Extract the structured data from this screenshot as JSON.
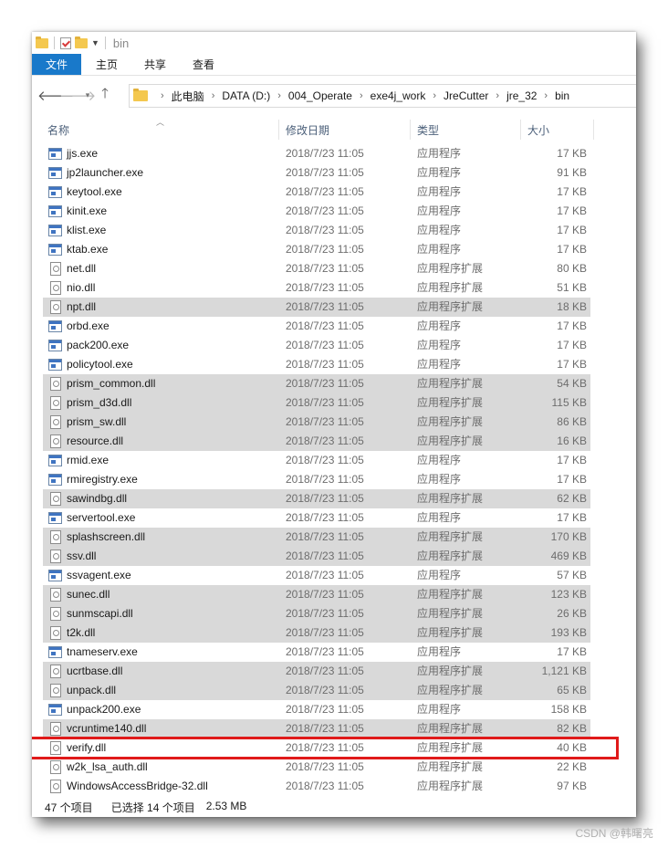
{
  "window": {
    "title": "bin"
  },
  "ribbon": {
    "tabs": [
      {
        "label": "文件",
        "active": true
      },
      {
        "label": "主页"
      },
      {
        "label": "共享"
      },
      {
        "label": "查看"
      }
    ]
  },
  "nav": {
    "back_icon": "arrow-left-icon",
    "forward_icon": "arrow-right-icon",
    "recent_icon": "chevron-down-icon",
    "up_icon": "arrow-up-icon"
  },
  "breadcrumb": [
    "此电脑",
    "DATA (D:)",
    "004_Operate",
    "exe4j_work",
    "JreCutter",
    "jre_32",
    "bin"
  ],
  "columns": {
    "name": "名称",
    "date": "修改日期",
    "type": "类型",
    "size": "大小"
  },
  "files": [
    {
      "name": "jjs.exe",
      "date": "2018/7/23 11:05",
      "type": "应用程序",
      "size": "17 KB",
      "kind": "exe",
      "selected": false
    },
    {
      "name": "jp2launcher.exe",
      "date": "2018/7/23 11:05",
      "type": "应用程序",
      "size": "91 KB",
      "kind": "exe",
      "selected": false
    },
    {
      "name": "keytool.exe",
      "date": "2018/7/23 11:05",
      "type": "应用程序",
      "size": "17 KB",
      "kind": "exe",
      "selected": false
    },
    {
      "name": "kinit.exe",
      "date": "2018/7/23 11:05",
      "type": "应用程序",
      "size": "17 KB",
      "kind": "exe",
      "selected": false
    },
    {
      "name": "klist.exe",
      "date": "2018/7/23 11:05",
      "type": "应用程序",
      "size": "17 KB",
      "kind": "exe",
      "selected": false
    },
    {
      "name": "ktab.exe",
      "date": "2018/7/23 11:05",
      "type": "应用程序",
      "size": "17 KB",
      "kind": "exe",
      "selected": false
    },
    {
      "name": "net.dll",
      "date": "2018/7/23 11:05",
      "type": "应用程序扩展",
      "size": "80 KB",
      "kind": "dll",
      "selected": false
    },
    {
      "name": "nio.dll",
      "date": "2018/7/23 11:05",
      "type": "应用程序扩展",
      "size": "51 KB",
      "kind": "dll",
      "selected": false
    },
    {
      "name": "npt.dll",
      "date": "2018/7/23 11:05",
      "type": "应用程序扩展",
      "size": "18 KB",
      "kind": "dll",
      "selected": true
    },
    {
      "name": "orbd.exe",
      "date": "2018/7/23 11:05",
      "type": "应用程序",
      "size": "17 KB",
      "kind": "exe",
      "selected": false
    },
    {
      "name": "pack200.exe",
      "date": "2018/7/23 11:05",
      "type": "应用程序",
      "size": "17 KB",
      "kind": "exe",
      "selected": false
    },
    {
      "name": "policytool.exe",
      "date": "2018/7/23 11:05",
      "type": "应用程序",
      "size": "17 KB",
      "kind": "exe",
      "selected": false
    },
    {
      "name": "prism_common.dll",
      "date": "2018/7/23 11:05",
      "type": "应用程序扩展",
      "size": "54 KB",
      "kind": "dll",
      "selected": true
    },
    {
      "name": "prism_d3d.dll",
      "date": "2018/7/23 11:05",
      "type": "应用程序扩展",
      "size": "115 KB",
      "kind": "dll",
      "selected": true
    },
    {
      "name": "prism_sw.dll",
      "date": "2018/7/23 11:05",
      "type": "应用程序扩展",
      "size": "86 KB",
      "kind": "dll",
      "selected": true
    },
    {
      "name": "resource.dll",
      "date": "2018/7/23 11:05",
      "type": "应用程序扩展",
      "size": "16 KB",
      "kind": "dll",
      "selected": true
    },
    {
      "name": "rmid.exe",
      "date": "2018/7/23 11:05",
      "type": "应用程序",
      "size": "17 KB",
      "kind": "exe",
      "selected": false
    },
    {
      "name": "rmiregistry.exe",
      "date": "2018/7/23 11:05",
      "type": "应用程序",
      "size": "17 KB",
      "kind": "exe",
      "selected": false
    },
    {
      "name": "sawindbg.dll",
      "date": "2018/7/23 11:05",
      "type": "应用程序扩展",
      "size": "62 KB",
      "kind": "dll",
      "selected": true
    },
    {
      "name": "servertool.exe",
      "date": "2018/7/23 11:05",
      "type": "应用程序",
      "size": "17 KB",
      "kind": "exe",
      "selected": false
    },
    {
      "name": "splashscreen.dll",
      "date": "2018/7/23 11:05",
      "type": "应用程序扩展",
      "size": "170 KB",
      "kind": "dll",
      "selected": true
    },
    {
      "name": "ssv.dll",
      "date": "2018/7/23 11:05",
      "type": "应用程序扩展",
      "size": "469 KB",
      "kind": "dll",
      "selected": true
    },
    {
      "name": "ssvagent.exe",
      "date": "2018/7/23 11:05",
      "type": "应用程序",
      "size": "57 KB",
      "kind": "exe",
      "selected": false
    },
    {
      "name": "sunec.dll",
      "date": "2018/7/23 11:05",
      "type": "应用程序扩展",
      "size": "123 KB",
      "kind": "dll",
      "selected": true
    },
    {
      "name": "sunmscapi.dll",
      "date": "2018/7/23 11:05",
      "type": "应用程序扩展",
      "size": "26 KB",
      "kind": "dll",
      "selected": true
    },
    {
      "name": "t2k.dll",
      "date": "2018/7/23 11:05",
      "type": "应用程序扩展",
      "size": "193 KB",
      "kind": "dll",
      "selected": true
    },
    {
      "name": "tnameserv.exe",
      "date": "2018/7/23 11:05",
      "type": "应用程序",
      "size": "17 KB",
      "kind": "exe",
      "selected": false
    },
    {
      "name": "ucrtbase.dll",
      "date": "2018/7/23 11:05",
      "type": "应用程序扩展",
      "size": "1,121 KB",
      "kind": "dll",
      "selected": true
    },
    {
      "name": "unpack.dll",
      "date": "2018/7/23 11:05",
      "type": "应用程序扩展",
      "size": "65 KB",
      "kind": "dll",
      "selected": true
    },
    {
      "name": "unpack200.exe",
      "date": "2018/7/23 11:05",
      "type": "应用程序",
      "size": "158 KB",
      "kind": "exe",
      "selected": false
    },
    {
      "name": "vcruntime140.dll",
      "date": "2018/7/23 11:05",
      "type": "应用程序扩展",
      "size": "82 KB",
      "kind": "dll",
      "selected": true
    },
    {
      "name": "verify.dll",
      "date": "2018/7/23 11:05",
      "type": "应用程序扩展",
      "size": "40 KB",
      "kind": "dll",
      "selected": false,
      "highlighted": true
    },
    {
      "name": "w2k_lsa_auth.dll",
      "date": "2018/7/23 11:05",
      "type": "应用程序扩展",
      "size": "22 KB",
      "kind": "dll",
      "selected": false
    },
    {
      "name": "WindowsAccessBridge-32.dll",
      "date": "2018/7/23 11:05",
      "type": "应用程序扩展",
      "size": "97 KB",
      "kind": "dll",
      "selected": false
    }
  ],
  "status": {
    "count": "47 个项目",
    "selection": "已选择 14 个项目",
    "size": "2.53 MB"
  },
  "watermark": "CSDN @韩曙亮",
  "colors": {
    "accent": "#1979ca",
    "selection": "#d9d9d9",
    "highlight_border": "#e01a1a"
  }
}
